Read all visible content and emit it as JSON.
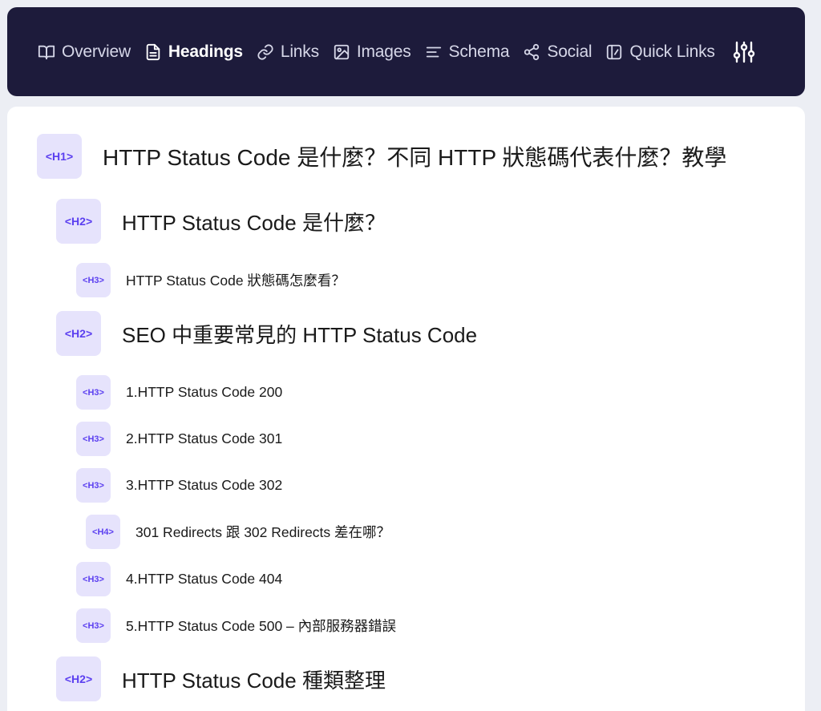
{
  "nav": {
    "items": [
      {
        "label": "Overview",
        "icon": "book-icon"
      },
      {
        "label": "Headings",
        "icon": "document-icon"
      },
      {
        "label": "Links",
        "icon": "link-icon"
      },
      {
        "label": "Images",
        "icon": "image-icon"
      },
      {
        "label": "Schema",
        "icon": "schema-lines-icon"
      },
      {
        "label": "Social",
        "icon": "share-icon"
      },
      {
        "label": "Quick Links",
        "icon": "quick-links-icon"
      }
    ],
    "active": "Headings",
    "settings_icon": "sliders-icon"
  },
  "headings": [
    {
      "level": "H1",
      "tag": "<H1>",
      "text": "HTTP Status Code 是什麼？不同 HTTP 狀態碼代表什麼？教學"
    },
    {
      "level": "H2",
      "tag": "<H2>",
      "text": "HTTP Status Code 是什麼？"
    },
    {
      "level": "H3",
      "tag": "<H3>",
      "text": "HTTP Status Code 狀態碼怎麼看？"
    },
    {
      "level": "H2",
      "tag": "<H2>",
      "text": "SEO 中重要常見的 HTTP Status Code"
    },
    {
      "level": "H3",
      "tag": "<H3>",
      "text": "1.HTTP Status Code 200"
    },
    {
      "level": "H3",
      "tag": "<H3>",
      "text": "2.HTTP Status Code 301"
    },
    {
      "level": "H3",
      "tag": "<H3>",
      "text": "3.HTTP Status Code 302"
    },
    {
      "level": "H4",
      "tag": "<H4>",
      "text": "301 Redirects 跟 302 Redirects 差在哪？"
    },
    {
      "level": "H3",
      "tag": "<H3>",
      "text": "4.HTTP Status Code 404"
    },
    {
      "level": "H3",
      "tag": "<H3>",
      "text": "5.HTTP Status Code 500 – 內部服務器錯誤"
    },
    {
      "level": "H2",
      "tag": "<H2>",
      "text": "HTTP Status Code 種類整理"
    }
  ],
  "colors": {
    "navbar_bg": "#1d1b3b",
    "tag_bg": "#e6e3fc",
    "tag_text": "#5b3ff0",
    "page_bg": "#eceef4"
  }
}
